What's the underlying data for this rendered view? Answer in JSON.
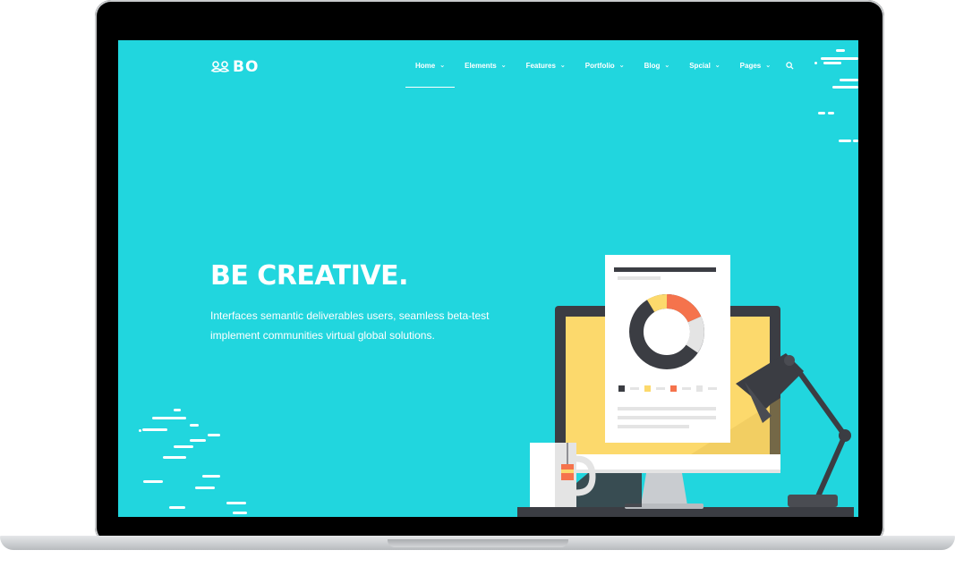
{
  "site": {
    "logo_text": "BO"
  },
  "nav": {
    "items": [
      {
        "label": "Home",
        "active": true
      },
      {
        "label": "Elements",
        "active": false
      },
      {
        "label": "Features",
        "active": false
      },
      {
        "label": "Portfolio",
        "active": false
      },
      {
        "label": "Blog",
        "active": false
      },
      {
        "label": "Spcial",
        "active": false
      },
      {
        "label": "Pages",
        "active": false
      }
    ],
    "search_icon": "search-icon",
    "chevron_icon": "chevron-down-icon"
  },
  "hero": {
    "title": "BE CREATIVE.",
    "line1": "Interfaces semantic deliverables users, seamless beta-test",
    "line2": "implement communities virtual global solutions."
  },
  "colors": {
    "background": "#21d6de",
    "accent_orange": "#f5734c",
    "accent_yellow": "#fcd96c",
    "dark": "#37393f",
    "light_gray": "#e4e4e4"
  }
}
